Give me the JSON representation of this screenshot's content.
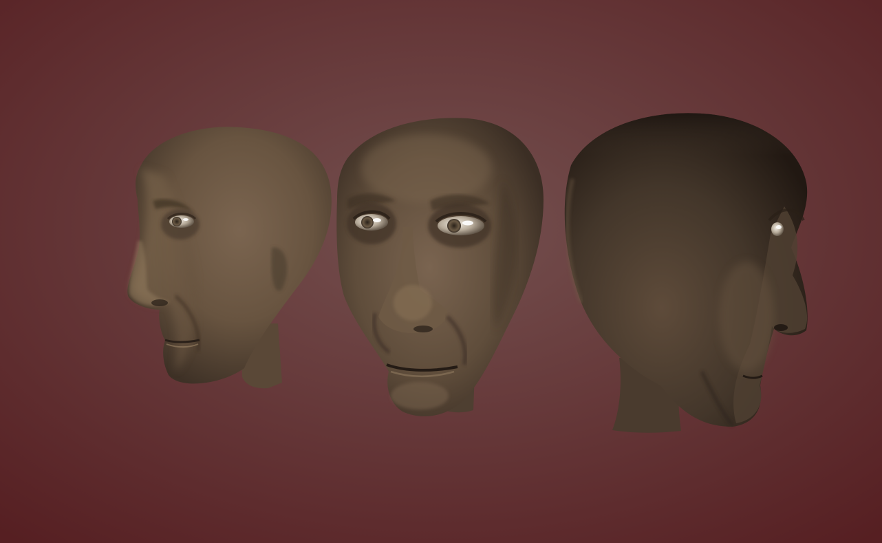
{
  "scene": {
    "background": {
      "center_color": "#74504f",
      "edge_color": "#561f22"
    },
    "skin": {
      "light": "#8c7558",
      "mid": "#6e5a45",
      "dark": "#3e3126",
      "shadow": "#251c16"
    },
    "eye": {
      "white": "#d9d2c6",
      "iris": "#6b5a45",
      "highlight": "#ffffff"
    },
    "heads": [
      {
        "view": "left-profile"
      },
      {
        "view": "three-quarter-front"
      },
      {
        "view": "right-rear-three-quarter"
      }
    ]
  }
}
